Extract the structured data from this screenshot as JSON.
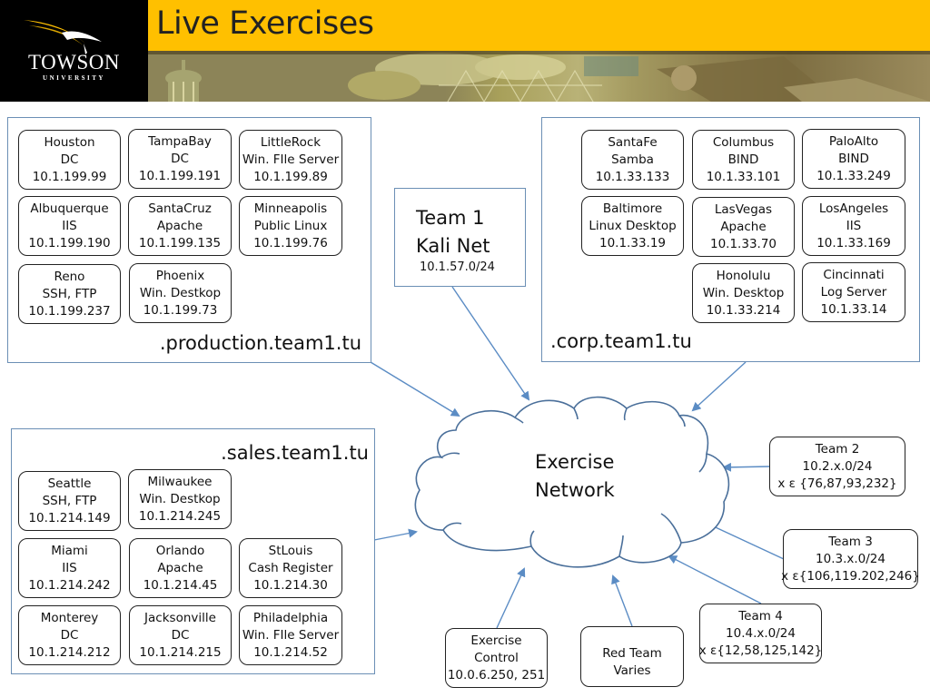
{
  "header": {
    "logo": {
      "name": "TOWSON",
      "subtitle": "UNIVERSITY"
    },
    "title": "Live Exercises",
    "accent_color": "#ffc000"
  },
  "diagram": {
    "zones": {
      "production": {
        "label": ".production.team1.tu",
        "nodes": [
          {
            "name": "Houston",
            "role": "DC",
            "ip": "10.1.199.99"
          },
          {
            "name": "TampaBay",
            "role": "DC",
            "ip": "10.1.199.191"
          },
          {
            "name": "LittleRock",
            "role": "Win. FIle Server",
            "ip": "10.1.199.89"
          },
          {
            "name": "Albuquerque",
            "role": "IIS",
            "ip": "10.1.199.190"
          },
          {
            "name": "SantaCruz",
            "role": "Apache",
            "ip": "10.1.199.135"
          },
          {
            "name": "Minneapolis",
            "role": "Public Linux",
            "ip": "10.1.199.76"
          },
          {
            "name": "Reno",
            "role": "SSH, FTP",
            "ip": "10.1.199.237"
          },
          {
            "name": "Phoenix",
            "role": "Win. Destkop",
            "ip": "10.1.199.73"
          }
        ]
      },
      "corp": {
        "label": ".corp.team1.tu",
        "nodes": [
          {
            "name": "SantaFe",
            "role": "Samba",
            "ip": "10.1.33.133"
          },
          {
            "name": "Columbus",
            "role": "BIND",
            "ip": "10.1.33.101"
          },
          {
            "name": "PaloAlto",
            "role": "BIND",
            "ip": "10.1.33.249"
          },
          {
            "name": "Baltimore",
            "role": "Linux Desktop",
            "ip": "10.1.33.19"
          },
          {
            "name": "LasVegas",
            "role": "Apache",
            "ip": "10.1.33.70"
          },
          {
            "name": "LosAngeles",
            "role": "IIS",
            "ip": "10.1.33.169"
          },
          {
            "name": "Honolulu",
            "role": "Win. Desktop",
            "ip": "10.1.33.214"
          },
          {
            "name": "Cincinnati",
            "role": "Log Server",
            "ip": "10.1.33.14"
          }
        ]
      },
      "sales": {
        "label": ".sales.team1.tu",
        "nodes": [
          {
            "name": "Seattle",
            "role": "SSH, FTP",
            "ip": "10.1.214.149"
          },
          {
            "name": "Milwaukee",
            "role": "Win. Destkop",
            "ip": "10.1.214.245"
          },
          {
            "name": "Miami",
            "role": "IIS",
            "ip": "10.1.214.242"
          },
          {
            "name": "Orlando",
            "role": "Apache",
            "ip": "10.1.214.45"
          },
          {
            "name": "StLouis",
            "role": "Cash Register",
            "ip": "10.1.214.30"
          },
          {
            "name": "Monterey",
            "role": "DC",
            "ip": "10.1.214.212"
          },
          {
            "name": "Jacksonville",
            "role": "DC",
            "ip": "10.1.214.215"
          },
          {
            "name": "Philadelphia",
            "role": "Win. FIle Server",
            "ip": "10.1.214.52"
          }
        ]
      }
    },
    "kali": {
      "line1": "Team 1",
      "line2": "Kali Net",
      "subnet": "10.1.57.0/24"
    },
    "cloud": {
      "line1": "Exercise",
      "line2": "Network"
    },
    "teams": [
      {
        "name": "Team 2",
        "subnet": "10.2.x.0/24",
        "set": "x ε {76,87,93,232}"
      },
      {
        "name": "Team 3",
        "subnet": "10.3.x.0/24",
        "set": "x ε{106,119.202,246}"
      },
      {
        "name": "Team 4",
        "subnet": "10.4.x.0/24",
        "set": "x ε{12,58,125,142}"
      }
    ],
    "control": {
      "line1": "Exercise",
      "line2": "Control",
      "line3": "10.0.6.250, 251"
    },
    "redteam": {
      "line1": "Red Team",
      "line2": "Varies"
    },
    "colors": {
      "zone_border": "#6b8fb5",
      "arrow": "#5b8cc4",
      "cloud_stroke": "#4a6f9a"
    }
  }
}
